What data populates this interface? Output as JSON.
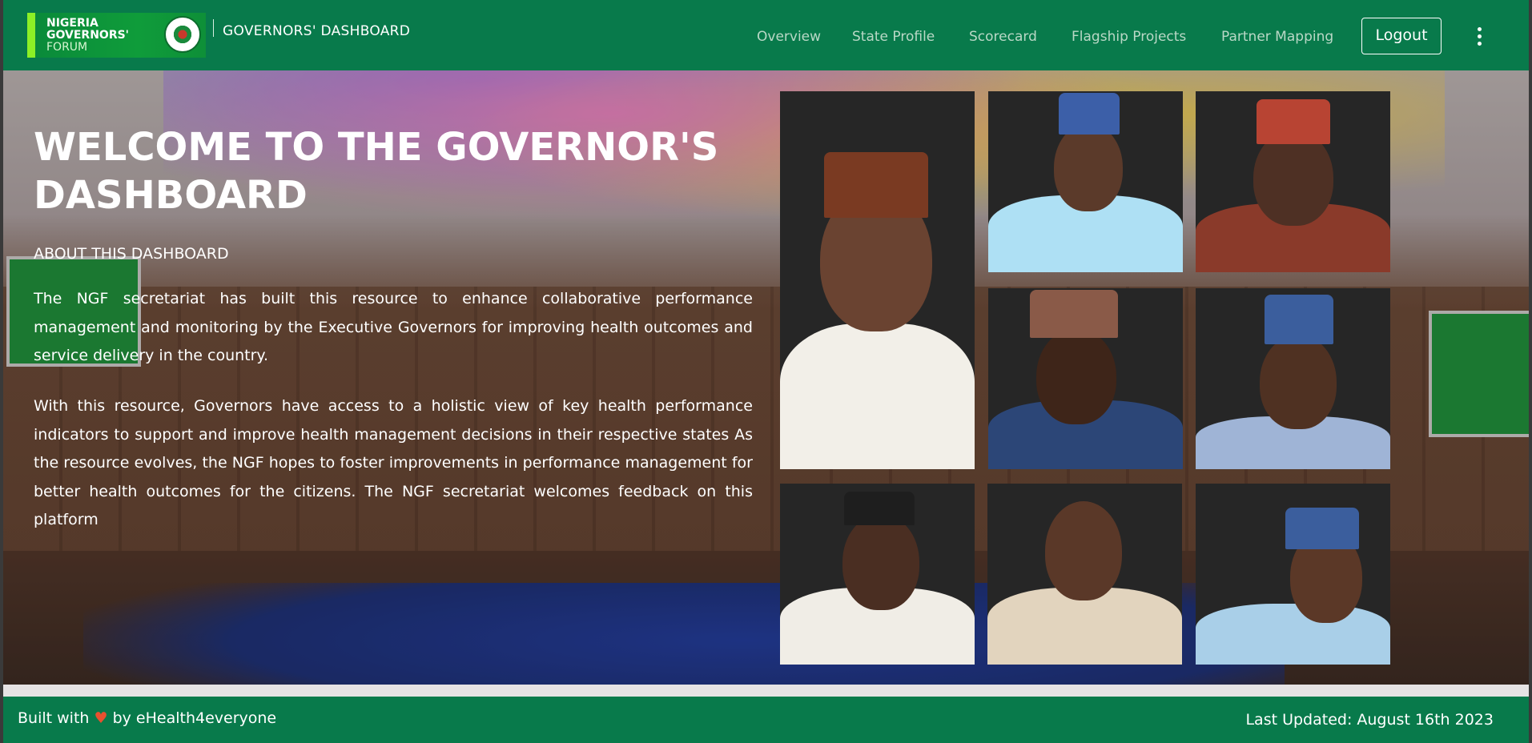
{
  "header": {
    "logo_line1": "NIGERIA",
    "logo_line2": "GOVERNORS'",
    "logo_line3": "FORUM",
    "brand_title": "GOVERNORS'  DASHBOARD",
    "nav": [
      "Overview",
      "State Profile",
      "Scorecard",
      "Flagship Projects",
      "Partner Mapping"
    ],
    "logout_label": "Logout",
    "menu_icon": "kebab-menu-icon"
  },
  "hero": {
    "title_line1": "WELCOME TO THE GOVERNOR'S",
    "title_line2": "DASHBOARD",
    "about_heading": "ABOUT THIS DASHBOARD",
    "paragraph1": "The NGF secretariat has built this resource to enhance collaborative performance management and monitoring by the Executive Governors for improving health outcomes and service delivery in the country.",
    "paragraph2": "With this resource, Governors have access to a holistic view of key health performance indicators to support and improve health management decisions in their respective states As the resource evolves, the NGF hopes to foster improvements in performance management for better health outcomes for the citizens. The NGF secretariat welcomes feedback on this platform"
  },
  "footer": {
    "built_prefix": "Built with",
    "heart": "♥",
    "built_suffix": "by eHealth4everyone",
    "last_updated": "Last Updated: August 16th 2023"
  },
  "colors": {
    "brand_green": "#087a4b",
    "logo_accent": "#8cf026",
    "heart": "#e8502f"
  }
}
